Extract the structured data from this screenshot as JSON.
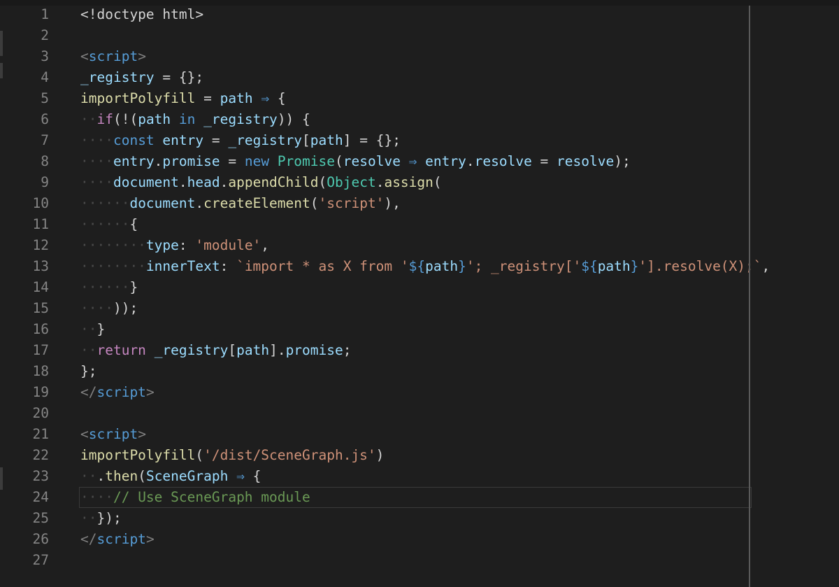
{
  "editor": {
    "line_numbers": [
      "1",
      "2",
      "3",
      "4",
      "5",
      "6",
      "7",
      "8",
      "9",
      "10",
      "11",
      "12",
      "13",
      "14",
      "15",
      "16",
      "17",
      "18",
      "19",
      "20",
      "21",
      "22",
      "23",
      "24",
      "25",
      "26",
      "27"
    ],
    "current_line": 24,
    "code_lines": [
      [
        [
          "pun",
          "<!doctype html>"
        ]
      ],
      [],
      [
        [
          "tag",
          "<"
        ],
        [
          "tagname",
          "script"
        ],
        [
          "tag",
          ">"
        ]
      ],
      [
        [
          "var",
          "_registry"
        ],
        [
          "pun",
          " = {};"
        ]
      ],
      [
        [
          "fn",
          "importPolyfill"
        ],
        [
          "pun",
          " = "
        ],
        [
          "var",
          "path"
        ],
        [
          "kw",
          " ⇒ "
        ],
        [
          "pun",
          "{"
        ]
      ],
      [
        [
          "ws",
          "··"
        ],
        [
          "ctrl",
          "if"
        ],
        [
          "pun",
          "(!("
        ],
        [
          "var",
          "path"
        ],
        [
          "kw",
          " in "
        ],
        [
          "var",
          "_registry"
        ],
        [
          "pun",
          ")) {"
        ]
      ],
      [
        [
          "ws",
          "····"
        ],
        [
          "kw",
          "const"
        ],
        [
          "var",
          " entry"
        ],
        [
          "pun",
          " = "
        ],
        [
          "var",
          "_registry"
        ],
        [
          "pun",
          "["
        ],
        [
          "var",
          "path"
        ],
        [
          "pun",
          "] = {};"
        ]
      ],
      [
        [
          "ws",
          "····"
        ],
        [
          "var",
          "entry"
        ],
        [
          "pun",
          "."
        ],
        [
          "var",
          "promise"
        ],
        [
          "pun",
          " = "
        ],
        [
          "kw",
          "new "
        ],
        [
          "cls",
          "Promise"
        ],
        [
          "pun",
          "("
        ],
        [
          "var",
          "resolve"
        ],
        [
          "kw",
          " ⇒ "
        ],
        [
          "var",
          "entry"
        ],
        [
          "pun",
          "."
        ],
        [
          "var",
          "resolve"
        ],
        [
          "pun",
          " = "
        ],
        [
          "var",
          "resolve"
        ],
        [
          "pun",
          ");"
        ]
      ],
      [
        [
          "ws",
          "····"
        ],
        [
          "var",
          "document"
        ],
        [
          "pun",
          "."
        ],
        [
          "var",
          "head"
        ],
        [
          "pun",
          "."
        ],
        [
          "fn",
          "appendChild"
        ],
        [
          "pun",
          "("
        ],
        [
          "cls",
          "Object"
        ],
        [
          "pun",
          "."
        ],
        [
          "fn",
          "assign"
        ],
        [
          "pun",
          "("
        ]
      ],
      [
        [
          "ws",
          "······"
        ],
        [
          "var",
          "document"
        ],
        [
          "pun",
          "."
        ],
        [
          "fn",
          "createElement"
        ],
        [
          "pun",
          "("
        ],
        [
          "str",
          "'script'"
        ],
        [
          "pun",
          "),"
        ]
      ],
      [
        [
          "ws",
          "······"
        ],
        [
          "pun",
          "{"
        ]
      ],
      [
        [
          "ws",
          "········"
        ],
        [
          "var",
          "type"
        ],
        [
          "pun",
          ": "
        ],
        [
          "str",
          "'module'"
        ],
        [
          "pun",
          ","
        ]
      ],
      [
        [
          "ws",
          "········"
        ],
        [
          "var",
          "innerText"
        ],
        [
          "pun",
          ": "
        ],
        [
          "str",
          "`import * as X from '"
        ],
        [
          "tmpl",
          "${"
        ],
        [
          "var",
          "path"
        ],
        [
          "tmpl",
          "}"
        ],
        [
          "str",
          "'; _registry['"
        ],
        [
          "tmpl",
          "${"
        ],
        [
          "var",
          "path"
        ],
        [
          "tmpl",
          "}"
        ],
        [
          "str",
          "'].resolve(X);`"
        ],
        [
          "pun",
          ","
        ]
      ],
      [
        [
          "ws",
          "······"
        ],
        [
          "pun",
          "}"
        ]
      ],
      [
        [
          "ws",
          "····"
        ],
        [
          "pun",
          "));"
        ]
      ],
      [
        [
          "ws",
          "··"
        ],
        [
          "pun",
          "}"
        ]
      ],
      [
        [
          "ws",
          "··"
        ],
        [
          "ctrl",
          "return"
        ],
        [
          "pun",
          " "
        ],
        [
          "var",
          "_registry"
        ],
        [
          "pun",
          "["
        ],
        [
          "var",
          "path"
        ],
        [
          "pun",
          "]."
        ],
        [
          "var",
          "promise"
        ],
        [
          "pun",
          ";"
        ]
      ],
      [
        [
          "pun",
          "};"
        ]
      ],
      [
        [
          "tag",
          "</"
        ],
        [
          "tagname",
          "script"
        ],
        [
          "tag",
          ">"
        ]
      ],
      [],
      [
        [
          "tag",
          "<"
        ],
        [
          "tagname",
          "script"
        ],
        [
          "tag",
          ">"
        ]
      ],
      [
        [
          "fn",
          "importPolyfill"
        ],
        [
          "pun",
          "("
        ],
        [
          "str",
          "'/dist/SceneGraph.js'"
        ],
        [
          "pun",
          ")"
        ]
      ],
      [
        [
          "ws",
          "··"
        ],
        [
          "pun",
          "."
        ],
        [
          "fn",
          "then"
        ],
        [
          "pun",
          "("
        ],
        [
          "var",
          "SceneGraph"
        ],
        [
          "kw",
          " ⇒ "
        ],
        [
          "pun",
          "{"
        ]
      ],
      [
        [
          "ws",
          "····"
        ],
        [
          "cm",
          "// Use SceneGraph module"
        ]
      ],
      [
        [
          "ws",
          "··"
        ],
        [
          "pun",
          "});"
        ]
      ],
      [
        [
          "tag",
          "</"
        ],
        [
          "tagname",
          "script"
        ],
        [
          "tag",
          ">"
        ]
      ],
      []
    ]
  },
  "colors": {
    "background": "#1e1e1e",
    "line_number": "#858585",
    "ruler": "#5a5a5a"
  }
}
